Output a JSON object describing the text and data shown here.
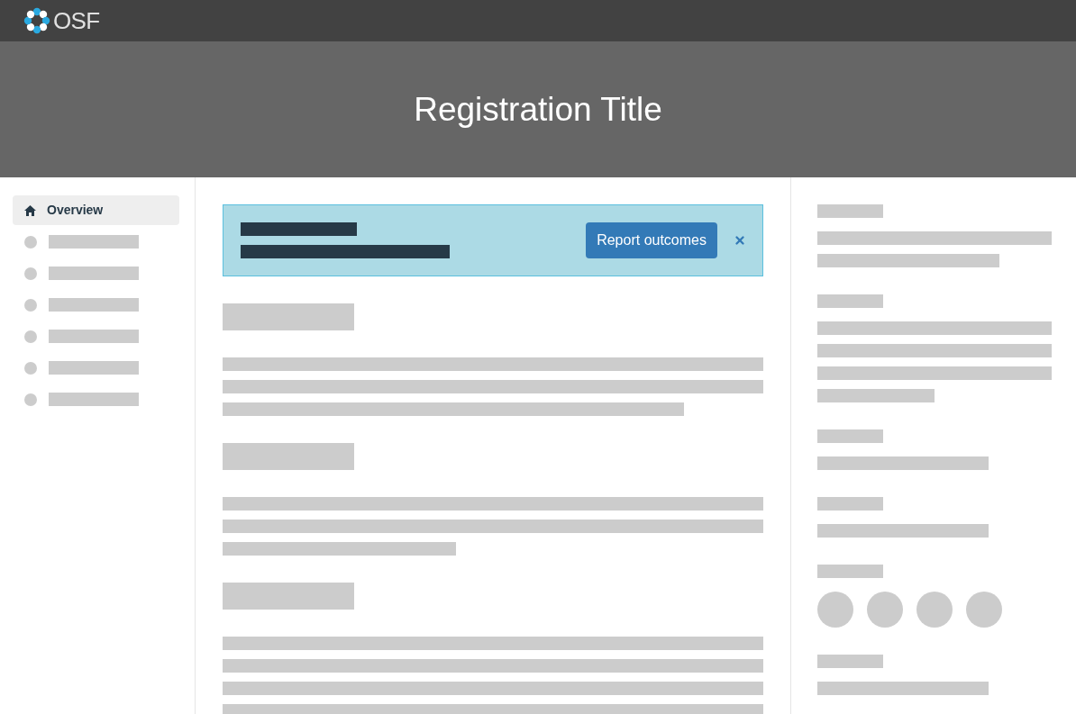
{
  "navbar": {
    "brand": "OSF"
  },
  "header": {
    "title": "Registration Title"
  },
  "sidebar": {
    "items": [
      {
        "label": "Overview",
        "selected": true
      }
    ]
  },
  "alert": {
    "button": "Report outcomes"
  }
}
